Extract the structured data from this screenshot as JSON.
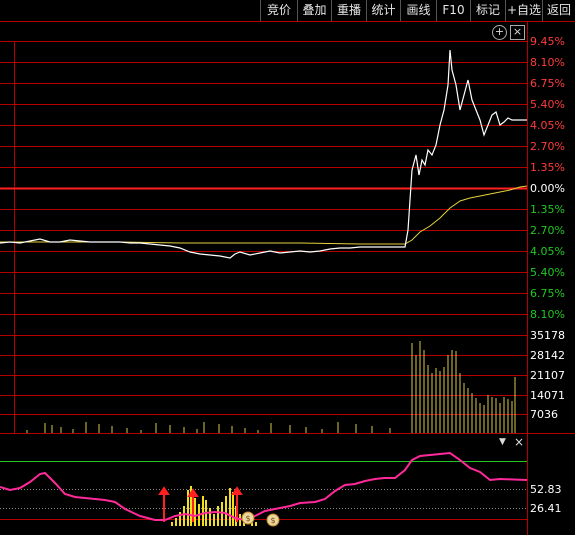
{
  "toolbar": {
    "items": [
      "竞价",
      "叠加",
      "重播",
      "统计",
      "画线",
      "F10",
      "标记",
      "+自选",
      "返回"
    ]
  },
  "price_pane": {
    "up_labels": [
      "9.45%",
      "8.10%",
      "6.75%",
      "5.40%",
      "4.05%",
      "2.70%",
      "1.35%"
    ],
    "zero_label": "0.00%",
    "down_labels": [
      "1.35%",
      "2.70%",
      "4.05%",
      "5.40%",
      "6.75%",
      "8.10%"
    ],
    "add_icon": "plus-circle-icon",
    "colors": {
      "up": "#ff3c3c",
      "down": "#22c722",
      "price_line": "#ffffff",
      "avg_line": "#e6d23c",
      "grid": "#b40000"
    }
  },
  "volume_pane": {
    "labels": [
      "35178",
      "28142",
      "21107",
      "14071",
      "7036"
    ],
    "bar_color": "#d7c84a"
  },
  "indicator_pane": {
    "collapse_icon": "triangle-down-icon",
    "close_icon": "close-icon",
    "labels": [
      "52.83",
      "26.41"
    ],
    "line_color": "#ff2a9a",
    "bar_color": "#f0e020",
    "marker_color": "#ff2020",
    "money_icon": "money-bag-icon"
  }
}
